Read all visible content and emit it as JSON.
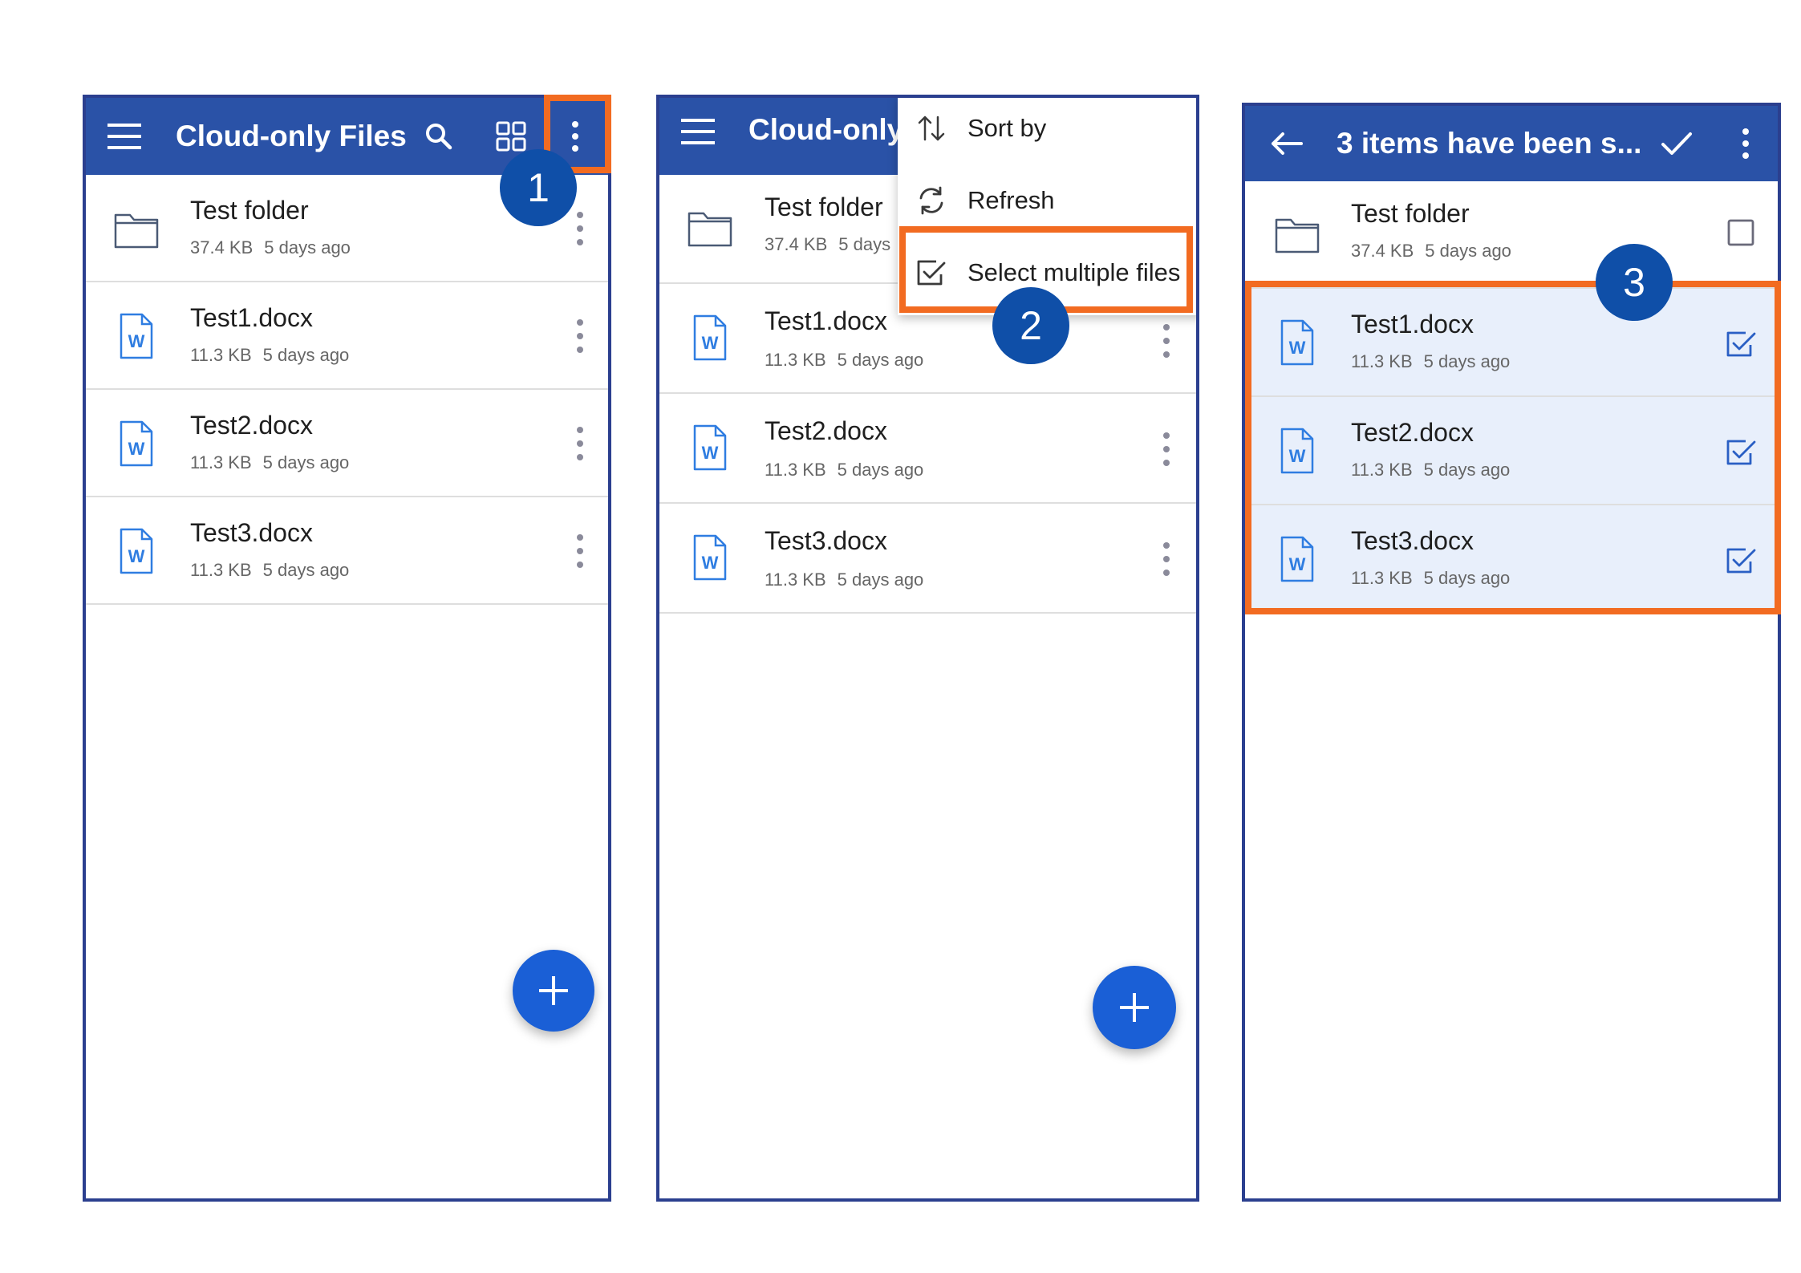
{
  "colors": {
    "app_bar": "#2a52a7",
    "accent_blue": "#1a5fd6",
    "highlight_orange": "#f26b21",
    "badge_blue": "#0f4fa8",
    "selected_row": "#e8effb"
  },
  "step_badges": [
    "1",
    "2",
    "3"
  ],
  "panel1": {
    "title": "Cloud-only Files",
    "icons": [
      "menu-icon",
      "search-icon",
      "grid-view-icon",
      "more-vert-icon"
    ],
    "items": [
      {
        "name": "Test folder",
        "size": "37.4 KB",
        "date": "5 days ago",
        "icon": "folder-icon"
      },
      {
        "name": "Test1.docx",
        "size": "11.3 KB",
        "date": "5 days ago",
        "icon": "word-doc-icon"
      },
      {
        "name": "Test2.docx",
        "size": "11.3 KB",
        "date": "5 days ago",
        "icon": "word-doc-icon"
      },
      {
        "name": "Test3.docx",
        "size": "11.3 KB",
        "date": "5 days ago",
        "icon": "word-doc-icon"
      }
    ]
  },
  "panel2": {
    "title": "Cloud-only",
    "menu": [
      {
        "label": "Sort by",
        "icon": "sort-icon"
      },
      {
        "label": "Refresh",
        "icon": "refresh-icon"
      },
      {
        "label": "Select multiple files",
        "icon": "checkbox-icon"
      }
    ],
    "items": [
      {
        "name": "Test folder",
        "size": "37.4 KB",
        "date": "5 days"
      },
      {
        "name": "Test1.docx",
        "size": "11.3 KB",
        "date": "5 days ago"
      },
      {
        "name": "Test2.docx",
        "size": "11.3 KB",
        "date": "5 days ago"
      },
      {
        "name": "Test3.docx",
        "size": "11.3 KB",
        "date": "5 days ago"
      }
    ]
  },
  "panel3": {
    "title": "3 items have been s...",
    "items": [
      {
        "name": "Test folder",
        "size": "37.4 KB",
        "date": "5 days ago",
        "checked": false
      },
      {
        "name": "Test1.docx",
        "size": "11.3 KB",
        "date": "5 days ago",
        "checked": true
      },
      {
        "name": "Test2.docx",
        "size": "11.3 KB",
        "date": "5 days ago",
        "checked": true
      },
      {
        "name": "Test3.docx",
        "size": "11.3 KB",
        "date": "5 days ago",
        "checked": true
      }
    ]
  }
}
